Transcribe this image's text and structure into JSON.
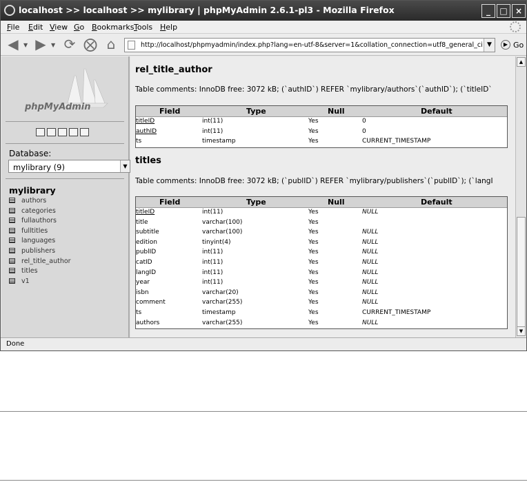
{
  "window": {
    "title": "localhost >> localhost >> mylibrary | phpMyAdmin 2.6.1-pl3 - Mozilla Firefox",
    "minimize_glyph": "_",
    "maximize_glyph": "□",
    "close_glyph": "×"
  },
  "menu": [
    {
      "u": "F",
      "rest": "ile"
    },
    {
      "u": "E",
      "rest": "dit"
    },
    {
      "u": "V",
      "rest": "iew"
    },
    {
      "u": "G",
      "rest": "o"
    },
    {
      "u": "B",
      "rest": "ookmarks"
    },
    {
      "u": "T",
      "rest": "ools"
    },
    {
      "u": "H",
      "rest": "elp"
    }
  ],
  "nav": {
    "url": "http://localhost/phpmyadmin/index.php?lang=en-utf-8&server=1&collation_connection=utf8_general_ci",
    "go_label": "Go"
  },
  "sidebar": {
    "logo_text": "phpMyAdmin",
    "db_label": "Database:",
    "db_selected": "mylibrary (9)",
    "db_name": "mylibrary",
    "tables": [
      "authors",
      "categories",
      "fullauthors",
      "fulltitles",
      "languages",
      "publishers",
      "rel_title_author",
      "titles",
      "v1"
    ]
  },
  "headers": {
    "field": "Field",
    "type": "Type",
    "null": "Null",
    "default": "Default"
  },
  "sections": [
    {
      "name": "rel_title_author",
      "comment": "Table comments: InnoDB free: 3072 kB; (`authID`) REFER `mylibrary/authors`(`authID`); (`titleID`",
      "rows": [
        {
          "field": "titleID",
          "type": "int(11)",
          "null": "Yes",
          "default": "0",
          "link": true,
          "italic": false
        },
        {
          "field": "authID",
          "type": "int(11)",
          "null": "Yes",
          "default": "0",
          "link": true,
          "italic": false
        },
        {
          "field": "ts",
          "type": "timestamp",
          "null": "Yes",
          "default": "CURRENT_TIMESTAMP",
          "link": false,
          "italic": false
        }
      ]
    },
    {
      "name": "titles",
      "comment": "Table comments: InnoDB free: 3072 kB; (`publID`) REFER `mylibrary/publishers`(`publID`); (`langI",
      "rows": [
        {
          "field": "titleID",
          "type": "int(11)",
          "null": "Yes",
          "default": "NULL",
          "link": true,
          "italic": true
        },
        {
          "field": "title",
          "type": "varchar(100)",
          "null": "Yes",
          "default": "",
          "link": false,
          "italic": false
        },
        {
          "field": "subtitle",
          "type": "varchar(100)",
          "null": "Yes",
          "default": "NULL",
          "link": false,
          "italic": true
        },
        {
          "field": "edition",
          "type": "tinyint(4)",
          "null": "Yes",
          "default": "NULL",
          "link": false,
          "italic": true
        },
        {
          "field": "publID",
          "type": "int(11)",
          "null": "Yes",
          "default": "NULL",
          "link": false,
          "italic": true
        },
        {
          "field": "catID",
          "type": "int(11)",
          "null": "Yes",
          "default": "NULL",
          "link": false,
          "italic": true
        },
        {
          "field": "langID",
          "type": "int(11)",
          "null": "Yes",
          "default": "NULL",
          "link": false,
          "italic": true
        },
        {
          "field": "year",
          "type": "int(11)",
          "null": "Yes",
          "default": "NULL",
          "link": false,
          "italic": true
        },
        {
          "field": "isbn",
          "type": "varchar(20)",
          "null": "Yes",
          "default": "NULL",
          "link": false,
          "italic": true
        },
        {
          "field": "comment",
          "type": "varchar(255)",
          "null": "Yes",
          "default": "NULL",
          "link": false,
          "italic": true
        },
        {
          "field": "ts",
          "type": "timestamp",
          "null": "Yes",
          "default": "CURRENT_TIMESTAMP",
          "link": false,
          "italic": false
        },
        {
          "field": "authors",
          "type": "varchar(255)",
          "null": "Yes",
          "default": "NULL",
          "link": false,
          "italic": true
        }
      ]
    }
  ],
  "status": "Done",
  "colors": {
    "titlebar": "#333333",
    "sidebar": "#d9d9d9",
    "content": "#ececec",
    "table_header": "#d3d3d3"
  }
}
